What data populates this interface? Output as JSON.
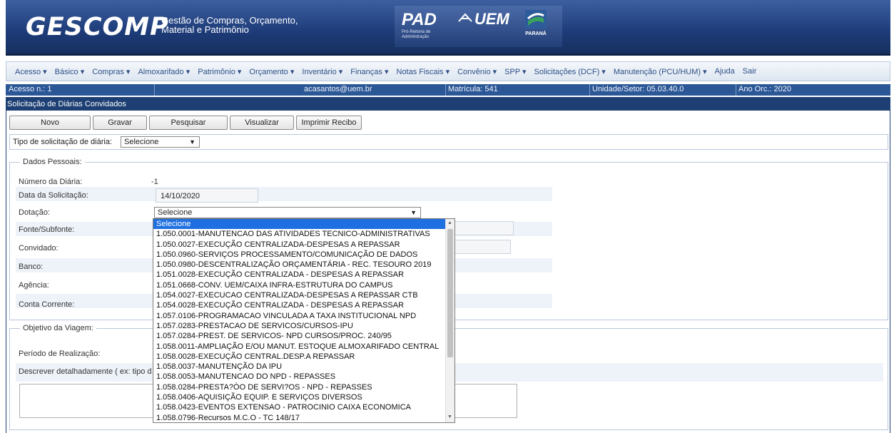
{
  "header": {
    "title": "GESCOMP",
    "subtitle_line1": "Gestão de Compras, Orçamento,",
    "subtitle_line2": "Material e Patrimônio",
    "pad": "PAD",
    "pad_sub_line1": "Pró-Reitoria de",
    "pad_sub_line2": "Administração",
    "uem": "UEM",
    "parana": "PARANÁ"
  },
  "menu": [
    "Acesso ▾",
    "Básico ▾",
    "Compras ▾",
    "Almoxarifado ▾",
    "Patrimônio ▾",
    "Orçamento ▾",
    "Inventário ▾",
    "Finanças ▾",
    "Notas Fiscais ▾",
    "Convênio ▾",
    "SPP ▾",
    "Solicitações (DCF) ▾",
    "Manutenção (PCU/HUM) ▾",
    "Ajuda",
    "Sair"
  ],
  "info": {
    "acesso": "Acesso n.: 1",
    "email": "acasantos@uem.br",
    "matricula": "Matrícula: 541",
    "unidade": "Unidade/Setor: 05.03.40.0",
    "ano": "Ano Orc.: 2020"
  },
  "section_title": "Solicitação de Diárias Convidados",
  "toolbar": {
    "novo": "Novo",
    "gravar": "Gravar",
    "pesquisar": "Pesquisar",
    "visualizar": "Visualizar",
    "imprimir": "Imprimir Recibo"
  },
  "tipo": {
    "label": "Tipo de solicitação de diária:",
    "value": "Selecione"
  },
  "dados": {
    "legend": "Dados Pessoais:",
    "numero_label": "Número da Diária:",
    "numero_value": "-1",
    "data_label": "Data da Solicitação:",
    "data_value": "14/10/2020",
    "dotacao_label": "Dotação:",
    "dotacao_value": "Selecione",
    "fonte_label": "Fonte/Subfonte:",
    "convidado_label": "Convidado:",
    "banco_label": "Banco:",
    "agencia_label": "Agência:",
    "conta_label": "Conta Corrente:"
  },
  "objetivo": {
    "legend": "Objetivo da Viagem:",
    "periodo_label": "Período de Realização:",
    "descrever_label": "Descrever detalhadamente ( ex: tipo d"
  },
  "dotacao_options": [
    "Selecione",
    "1.050.0001-MANUTENCAO DAS ATIVIDADES TECNICO-ADMINISTRATIVAS",
    "1.050.0027-EXECUÇÃO CENTRALIZADA-DESPESAS A REPASSAR",
    "1.050.0960-SERVIÇOS PROCESSAMENTO/COMUNICAÇÃO DE DADOS",
    "1.050.0980-DESCENTRALIZAÇÃO ORÇAMENTÁRIA - REC. TESOURO 2019",
    "1.051.0028-EXECUÇÃO CENTRALIZADA - DESPESAS A REPASSAR",
    "1.051.0668-CONV. UEM/CAIXA INFRA-ESTRUTURA DO CAMPUS",
    "1.054.0027-EXECUCAO CENTRALIZADA-DESPESAS A REPASSAR CTB",
    "1.054.0028-EXECUÇÃO CENTRALIZADA - DESPESAS A REPASSAR",
    "1.057.0106-PROGRAMACAO VINCULADA A TAXA INSTITUCIONAL NPD",
    "1.057.0283-PRESTACAO DE SERVICOS/CURSOS-IPU",
    "1.057.0284-PREST. DE SERVICOS- NPD CURSOS/PROC. 240/95",
    "1.058.0011-AMPLIAÇÃO E/OU MANUT. ESTOQUE ALMOXARIFADO CENTRAL",
    "1.058.0028-EXECUÇÃO CENTRAL.DESP.A REPASSAR",
    "1.058.0037-MANUTENÇÃO DA IPU",
    "1.058.0053-MANUTENCAO DO NPD - REPASSES",
    "1.058.0284-PRESTA?ÒO DE SERVI?OS - NPD - REPASSES",
    "1.058.0406-AQUISIÇÃO EQUIP. E SERVIÇOS DIVERSOS",
    "1.058.0423-EVENTOS EXTENSAO - PATROCINIO CAIXA ECONOMICA",
    "1.058.0796-Recursos M.C.O - TC 148/17"
  ]
}
